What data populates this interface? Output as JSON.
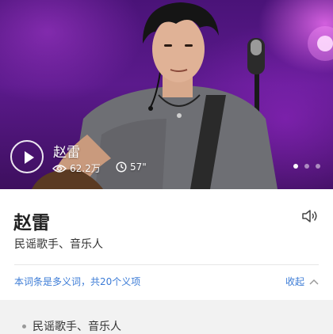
{
  "hero": {
    "name": "赵雷",
    "views": "62.2万",
    "duration": "57\"",
    "carousel": {
      "count": 3,
      "active": 1
    }
  },
  "entry": {
    "title": "赵雷",
    "subtitle": "民谣歌手、音乐人",
    "polysemy_note": "本词条是多义词，共20个义项",
    "collapse_label": "收起"
  },
  "senses": [
    {
      "label": "民谣歌手、音乐人"
    }
  ],
  "colors": {
    "link": "#3b7bd6",
    "hero_bg": "#4a1378"
  }
}
